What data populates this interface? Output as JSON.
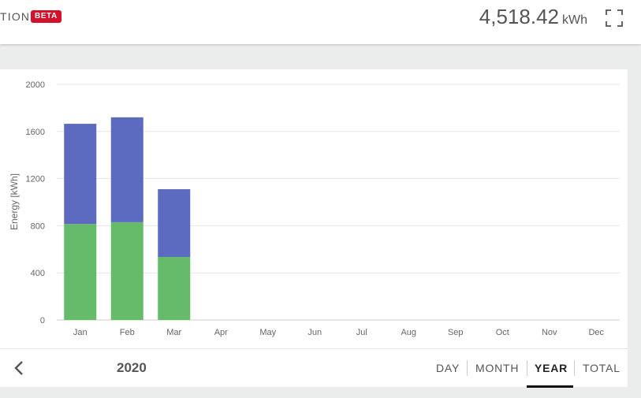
{
  "header": {
    "title": "TION",
    "badge": "BETA",
    "total_value": "4,518.42",
    "total_unit": "kWh",
    "fullscreen_icon": "fullscreen-icon"
  },
  "footer": {
    "year": "2020",
    "prev_icon": "chevron-left-icon",
    "tabs": [
      {
        "label": "DAY",
        "active": false
      },
      {
        "label": "MONTH",
        "active": false
      },
      {
        "label": "YEAR",
        "active": true
      },
      {
        "label": "TOTAL",
        "active": false
      }
    ]
  },
  "colors": {
    "series_green": "#66bb6a",
    "series_blue": "#5c6bc0",
    "badge": "#d3112b"
  },
  "chart_data": {
    "type": "bar",
    "stacked": true,
    "ylabel": "Energy [kWh]",
    "xlabel": "",
    "ylim": [
      0,
      2000
    ],
    "yticks": [
      0,
      400,
      800,
      1200,
      1600,
      2000
    ],
    "grid": true,
    "categories": [
      "Jan",
      "Feb",
      "Mar",
      "Apr",
      "May",
      "Jun",
      "Jul",
      "Aug",
      "Sep",
      "Oct",
      "Nov",
      "Dec"
    ],
    "series": [
      {
        "color": "#66bb6a",
        "values": [
          815,
          830,
          535,
          0,
          0,
          0,
          0,
          0,
          0,
          0,
          0,
          0
        ]
      },
      {
        "color": "#5c6bc0",
        "values": [
          850,
          890,
          575,
          0,
          0,
          0,
          0,
          0,
          0,
          0,
          0,
          0
        ]
      }
    ]
  }
}
